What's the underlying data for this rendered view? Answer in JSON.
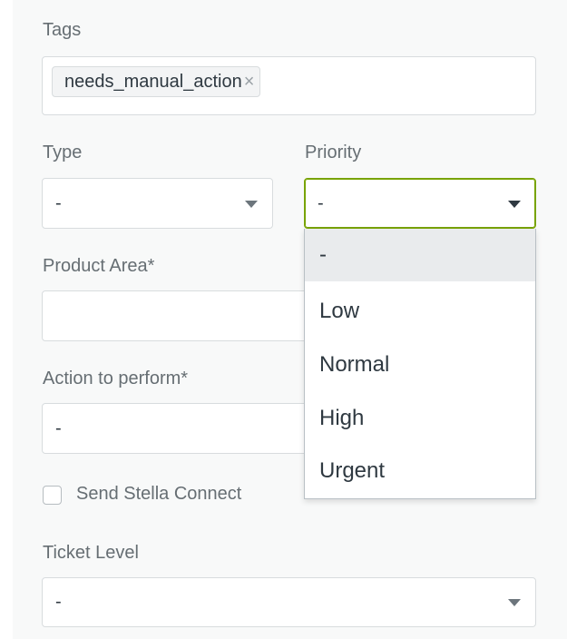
{
  "tags": {
    "label": "Tags",
    "items": [
      {
        "text": "needs_manual_action",
        "remove": "×"
      }
    ]
  },
  "type": {
    "label": "Type",
    "value": "-"
  },
  "priority": {
    "label": "Priority",
    "value": "-",
    "options": [
      "-",
      "Low",
      "Normal",
      "High",
      "Urgent"
    ]
  },
  "product_area": {
    "label": "Product Area*",
    "value": ""
  },
  "action": {
    "label": "Action to perform*",
    "value": "-"
  },
  "stella": {
    "label": "Send Stella Connect",
    "checked": false
  },
  "ticket_level": {
    "label": "Ticket Level",
    "value": "-"
  },
  "colors": {
    "focus": "#78a300",
    "label": "#666e73",
    "text": "#2f3941",
    "border": "#d8dcde"
  }
}
